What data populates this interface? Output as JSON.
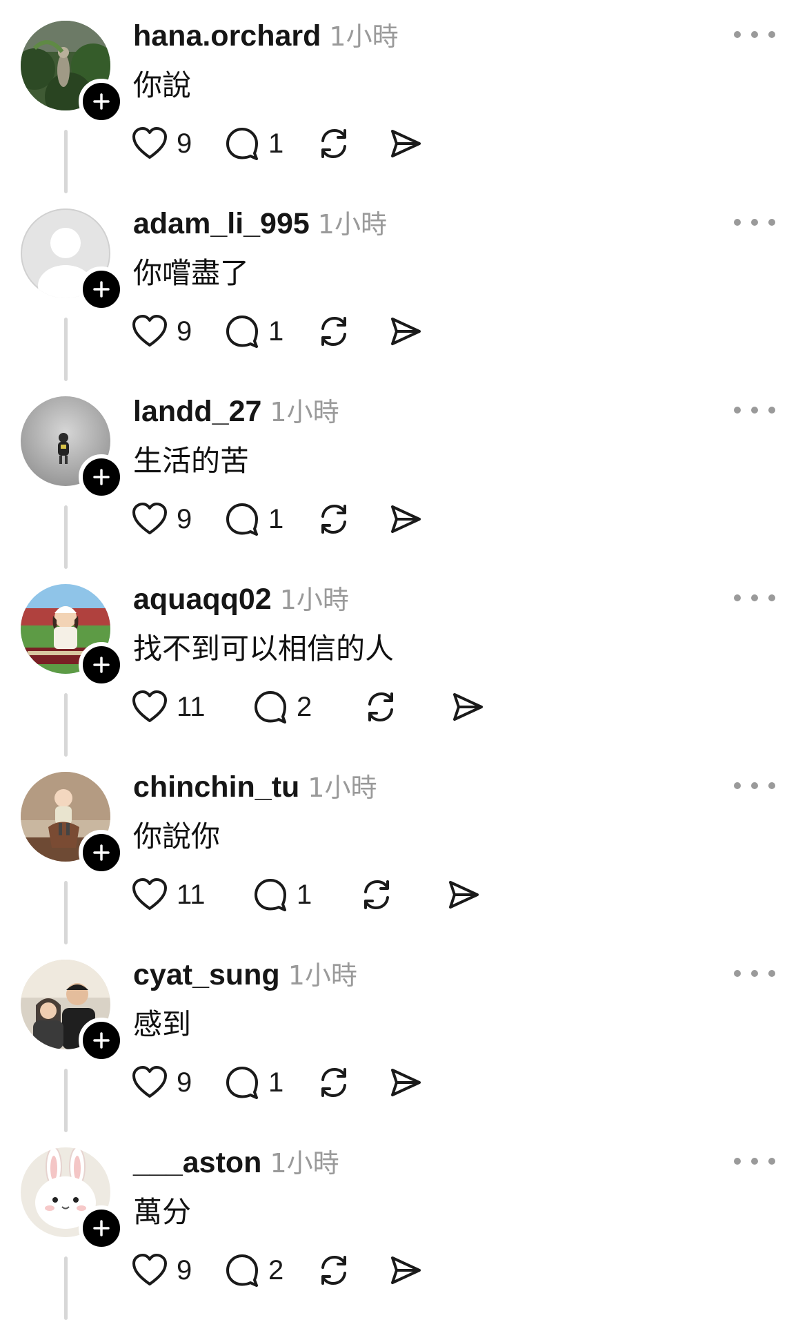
{
  "posts": [
    {
      "username": "hana.orchard",
      "time": "1小時",
      "text": "你說",
      "likes": "9",
      "replies": "1",
      "avatar_icon": "jungle-photo-avatar"
    },
    {
      "username": "adam_li_995",
      "time": "1小時",
      "text": "你嚐盡了",
      "likes": "9",
      "replies": "1",
      "avatar_icon": "default-person-avatar"
    },
    {
      "username": "landd_27",
      "time": "1小時",
      "text": "生活的苦",
      "likes": "9",
      "replies": "1",
      "avatar_icon": "grey-photo-avatar"
    },
    {
      "username": "aquaqq02",
      "time": "1小時",
      "text": "找不到可以相信的人",
      "likes": "11",
      "replies": "2",
      "avatar_icon": "baseball-stadium-avatar"
    },
    {
      "username": "chinchin_tu",
      "time": "1小時",
      "text": "你說你",
      "likes": "11",
      "replies": "1",
      "avatar_icon": "child-photo-avatar"
    },
    {
      "username": "cyat_sung",
      "time": "1小時",
      "text": "感到",
      "likes": "9",
      "replies": "1",
      "avatar_icon": "couple-selfie-avatar"
    },
    {
      "username": "___aston",
      "time": "1小時",
      "text": "萬分",
      "likes": "9",
      "replies": "2",
      "avatar_icon": "bunny-avatar"
    }
  ],
  "colors": {
    "text": "#161616",
    "muted": "#9a9a9a",
    "thread_line": "#d7d7d7",
    "follow_badge": "#000000",
    "background": "#ffffff"
  },
  "icons": {
    "like": "heart-icon",
    "reply": "speech-bubble-icon",
    "repost": "repost-arrows-icon",
    "share": "paper-plane-icon",
    "more": "ellipsis-icon",
    "follow": "plus-icon"
  }
}
